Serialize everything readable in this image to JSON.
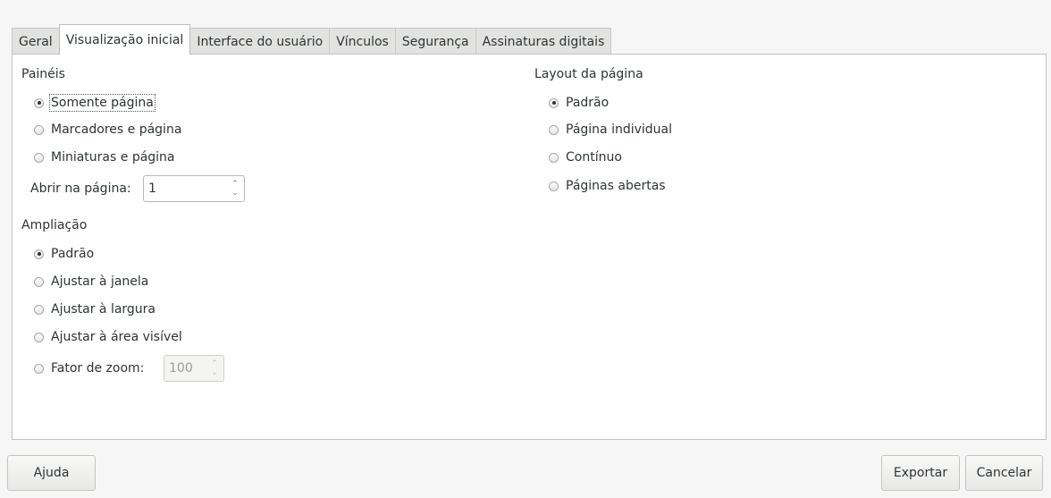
{
  "tabs": [
    {
      "label": "Geral"
    },
    {
      "label": "Visualização inicial"
    },
    {
      "label": "Interface do usuário"
    },
    {
      "label": "Vínculos"
    },
    {
      "label": "Segurança"
    },
    {
      "label": "Assinaturas digitais"
    }
  ],
  "active_tab": "Visualização inicial",
  "panels": {
    "heading": "Painéis",
    "options": [
      {
        "label": "Somente página",
        "checked": true
      },
      {
        "label": "Marcadores e página",
        "checked": false
      },
      {
        "label": "Miniaturas e página",
        "checked": false
      }
    ],
    "open_page_label": "Abrir na página:",
    "open_page_value": "1"
  },
  "magnification": {
    "heading": "Ampliação",
    "options": [
      {
        "label": "Padrão",
        "checked": true
      },
      {
        "label": "Ajustar à janela",
        "checked": false
      },
      {
        "label": "Ajustar à largura",
        "checked": false
      },
      {
        "label": "Ajustar à área visível",
        "checked": false
      },
      {
        "label": "Fator de zoom:",
        "checked": false
      }
    ],
    "zoom_value": "100"
  },
  "page_layout": {
    "heading": "Layout da página",
    "options": [
      {
        "label": "Padrão",
        "checked": true
      },
      {
        "label": "Página individual",
        "checked": false
      },
      {
        "label": "Contínuo",
        "checked": false
      },
      {
        "label": "Páginas abertas",
        "checked": false
      }
    ]
  },
  "buttons": {
    "help": "Ajuda",
    "export": "Exportar",
    "cancel": "Cancelar"
  }
}
